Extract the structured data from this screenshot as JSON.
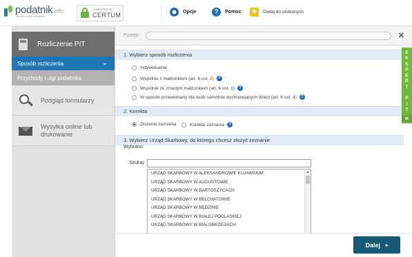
{
  "header": {
    "logo_main": "podatnik",
    "logo_suffix": ".info",
    "logo_tagline": "prosto online podatków",
    "certum_small": "ZABEZPIECZA",
    "certum_big": "CERTUM",
    "links": [
      {
        "label": "Opcje",
        "icon": "gear-icon"
      },
      {
        "label": "Pomoc",
        "icon": "help-icon"
      },
      {
        "label": "Dodaj do ulubionych",
        "icon": "star-icon"
      }
    ]
  },
  "sidebar": {
    "head_label": "Rozliczenie PIT",
    "active_item": "Sposób rozliczenia",
    "secondary_item": "Przychody i ulgi podatnika",
    "items": [
      {
        "label": "Podgląd formularzy",
        "icon": "magnifier-icon"
      },
      {
        "label_line1": "Wysyłka online lub",
        "label_line2": "drukowanie",
        "icon": "envelope-icon"
      }
    ]
  },
  "progress": {
    "label": "Postęp:",
    "value_percent": 0
  },
  "sections": {
    "s1_title": "1. Wybierz sposób rozliczenia",
    "s1_options": [
      "Indywidualnie",
      "Wspólnie z małżonkiem (art. 6 ust. 2)",
      "Wspólnie ze zmarłym małżonkiem (art. 6 ust. 1)",
      "W sposób przewidziany dla osób samotnie wychowujących dzieci (art. 6 ust. 4)"
    ],
    "s2_title": "2. Korekta",
    "s2_options": [
      "Złożenie zeznania",
      "Korekta zeznania"
    ],
    "s3_title": "3. Wybierz Urząd Skarbowy, do którego chcesz złożyć zeznanie",
    "selected_label": "Wybrano:",
    "search_label": "Szukaj:",
    "search_value": "",
    "offices": [
      "URZĄD SKARBOWY W ALEKSANDROWIE KUJAWSKIM",
      "URZĄD SKARBOWY W AUGUSTOWIE",
      "URZĄD SKARBOWY W BARTOSZYCACH",
      "URZĄD SKARBOWY W BEŁCHATOWIE",
      "URZĄD SKARBOWY W BĘDZINIE",
      "URZĄD SKARBOWY W BIAŁEJ PODLASKIEJ",
      "URZĄD SKARBOWY W BIAŁOBRZEGACH"
    ]
  },
  "footer": {
    "next_label": "Dalej"
  },
  "ekspert": {
    "label": "EKSPERT PIT",
    "chevrons": "«"
  }
}
